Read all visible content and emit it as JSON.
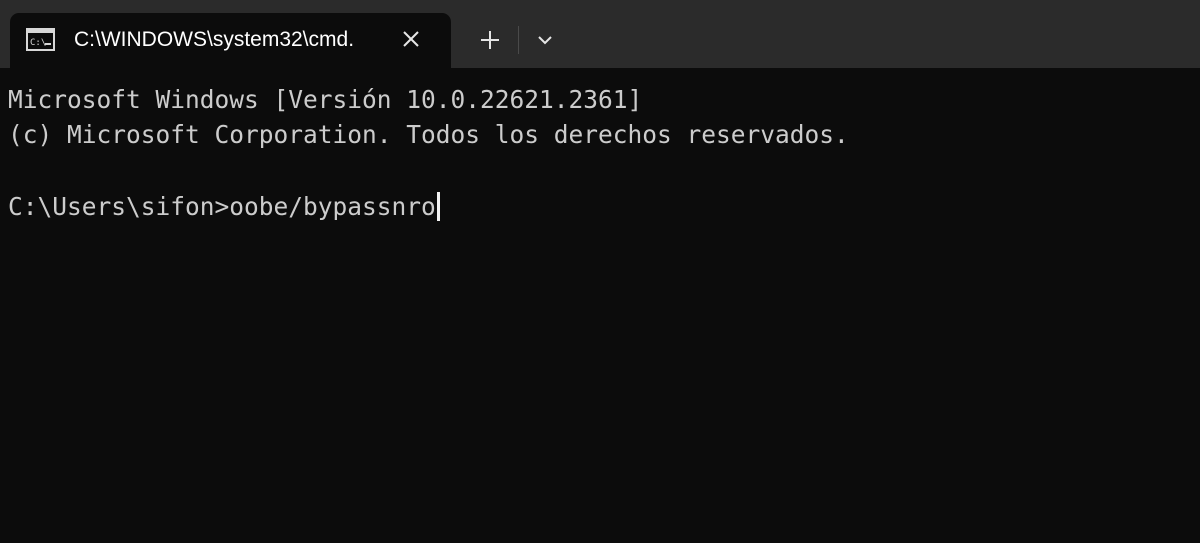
{
  "tab": {
    "title": "C:\\WINDOWS\\system32\\cmd.",
    "icon": "command-prompt-icon",
    "close_icon": "close-icon"
  },
  "tabbar": {
    "new_tab_icon": "plus-icon",
    "dropdown_icon": "chevron-down-icon"
  },
  "console": {
    "line1": "Microsoft Windows [Versión 10.0.22621.2361]",
    "line2": "(c) Microsoft Corporation. Todos los derechos reservados.",
    "prompt": "C:\\Users\\sifon>",
    "command": "oobe/bypassnro"
  },
  "colors": {
    "tabbar_background": "#2b2b2b",
    "console_background": "#0c0c0c",
    "console_text": "#cccccc",
    "tab_text": "#ffffff"
  }
}
